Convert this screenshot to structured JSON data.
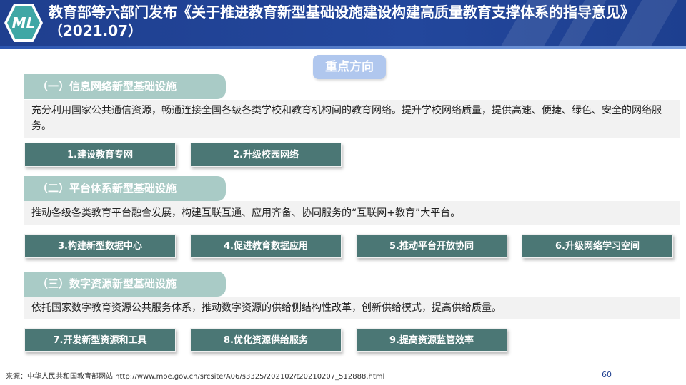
{
  "header": {
    "logo_text": "ML",
    "title": "教育部等六部门发布《关于推进教育新型基础设施建设构建高质量教育支撑体系的指导意见》（2021.07）"
  },
  "focus_label": "重点方向",
  "sections": [
    {
      "title": "（一）信息网络新型基础设施",
      "description": "充分利用国家公共通信资源，畅通连接全国各级各类学校和教育机构间的教育网络。提升学校网络质量，提供高速、便捷、绿色、安全的网络服务。",
      "items": [
        "1.建设教育专网",
        "2.升级校园网络"
      ]
    },
    {
      "title": "（二）平台体系新型基础设施",
      "description": "推动各级各类教育平台融合发展，构建互联互通、应用齐备、协同服务的“互联网+教育”大平台。",
      "items": [
        "3.构建新型数据中心",
        "4.促进教育数据应用",
        "5.推动平台开放协同",
        "6.升级网络学习空间"
      ]
    },
    {
      "title": "（三）数字资源新型基础设施",
      "description": "依托国家数字教育资源公共服务体系，推动数字资源的供给侧结构性改革，创新供给模式，提高供给质量。",
      "items": [
        "7.开发新型资源和工具",
        "8.优化资源供给服务",
        "9.提高资源监管效率"
      ]
    }
  ],
  "footer": {
    "source_label": "来源：",
    "source_text": "中华人民共和国教育部网站 http://www.moe.gov.cn/srcsite/A06/s3325/202102/t20210207_512888.html",
    "page_number": "60"
  },
  "colors": {
    "header_bg": "#1f3f8f",
    "tab_bg": "#a9cbc6",
    "button_bg": "#4b7775",
    "pill_bg": "#b0c7ee"
  }
}
